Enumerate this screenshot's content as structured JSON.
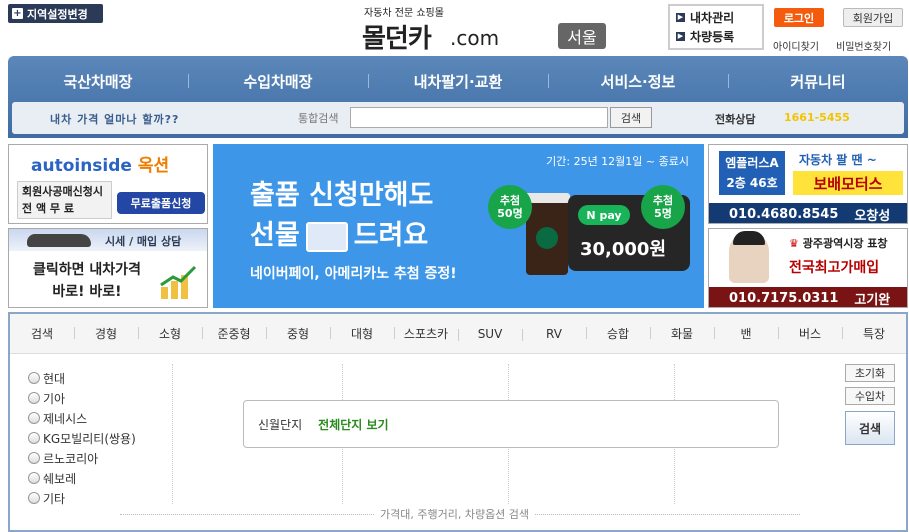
{
  "header": {
    "region_button": "지역설정변경",
    "tagline": "자동차 전문 쇼핑몰",
    "logo_name": "몰던카",
    "logo_domain": ".com",
    "region": "서울",
    "my_car_manage": "내차관리",
    "car_register": "차량등록",
    "login": "로그인",
    "join": "회원가입",
    "find_id": "아이디찾기",
    "find_pw": "비밀번호찾기"
  },
  "nav": {
    "items": [
      "국산차매장",
      "수입차매장",
      "내차팔기·교환",
      "서비스·정보",
      "커뮤니티"
    ],
    "slogan": "내차 가격 얼마나 할까??",
    "search_label": "통합검색",
    "search_value": "",
    "search_button": "검색",
    "phone_label": "전화상담",
    "phone": "1661-5455"
  },
  "banners": {
    "autoinside": {
      "brand": "autoinside",
      "brand_suffix": "옥션",
      "line1": "회원사공매신청시",
      "line2": "전 액 무 료",
      "apply": "무료출품신청"
    },
    "price_check": {
      "header": "시세 / 매입 상담",
      "line1": "클릭하면 내차가격",
      "line2": "바로! 바로!"
    },
    "promo": {
      "period": "기간: 25년 12월1일 ~ 종료시",
      "line1": "출품 신청만해도",
      "line2a": "선물",
      "line2b": "드려요",
      "line3": "네이버페이, 아메리카노 추첨 증정!",
      "badge1_a": "추첨",
      "badge1_b": "50명",
      "badge2_a": "추첨",
      "badge2_b": "5명",
      "npay": "N pay",
      "amount": "30,000원"
    },
    "bobae": {
      "emplace_a": "엠플러스A",
      "emplace_b": "2층 46호",
      "line1": "자동차 팔 땐 ~",
      "line2": "보배모터스",
      "phone": "010.4680.8545",
      "name": "오창성"
    },
    "gwangju": {
      "line1_a": "광주광역시장",
      "line1_b": "표창",
      "line2": "전국최고가매입",
      "phone": "010.7175.0311",
      "name": "고기완"
    }
  },
  "search_panel": {
    "tabs": [
      "검색",
      "경형",
      "소형",
      "준중형",
      "중형",
      "대형",
      "스포츠카",
      "SUV",
      "RV",
      "승합",
      "화물",
      "밴",
      "버스",
      "특장"
    ],
    "brands": [
      "현대",
      "기아",
      "제네시스",
      "KG모빌리티(쌍용)",
      "르노코리아",
      "쉐보레",
      "기타"
    ],
    "complex_label": "신월단지",
    "complex_link": "전체단지 보기",
    "reset": "초기화",
    "import": "수입차",
    "search": "검색",
    "more": "가격대, 주행거리, 차량옵션 검색"
  }
}
